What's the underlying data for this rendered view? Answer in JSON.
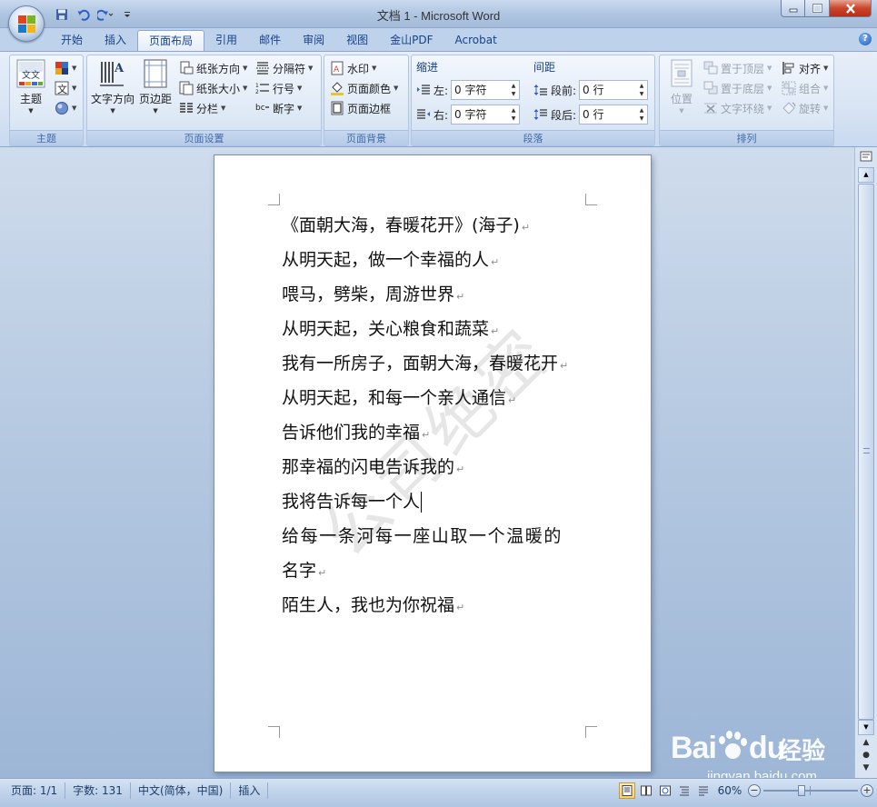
{
  "app": {
    "title": "文档 1 - Microsoft Word"
  },
  "tabs": [
    "开始",
    "插入",
    "页面布局",
    "引用",
    "邮件",
    "审阅",
    "视图",
    "金山PDF",
    "Acrobat"
  ],
  "active_tab": "页面布局",
  "ribbon": {
    "themes": {
      "label": "主题",
      "theme_button": "主题"
    },
    "page_setup": {
      "label": "页面设置",
      "text_direction": "文字方向",
      "margins": "页边距",
      "orientation": "纸张方向",
      "size": "纸张大小",
      "columns": "分栏",
      "breaks": "分隔符",
      "line_numbers": "行号",
      "hyphenation": "断字"
    },
    "page_background": {
      "label": "页面背景",
      "watermark": "水印",
      "page_color": "页面颜色",
      "page_borders": "页面边框"
    },
    "paragraph": {
      "label": "段落",
      "indent_title": "缩进",
      "spacing_title": "间距",
      "indent_left_label": "左:",
      "indent_left_value": "0 字符",
      "indent_right_label": "右:",
      "indent_right_value": "0 字符",
      "spacing_before_label": "段前:",
      "spacing_before_value": "0 行",
      "spacing_after_label": "段后:",
      "spacing_after_value": "0 行"
    },
    "arrange": {
      "label": "排列",
      "position": "位置",
      "bring_to_front": "置于顶层",
      "send_to_back": "置于底层",
      "text_wrapping": "文字环绕",
      "align": "对齐",
      "group": "组合",
      "rotate": "旋转"
    }
  },
  "document": {
    "watermark_text": "公司绝密",
    "paragraphs": [
      "《面朝大海，春暖花开》(海子)",
      "从明天起，做一个幸福的人",
      "喂马，劈柴，周游世界",
      "从明天起，关心粮食和蔬菜",
      "我有一所房子，面朝大海，春暖花开",
      "从明天起，和每一个亲人通信",
      "告诉他们我的幸福",
      "那幸福的闪电告诉我的",
      "我将告诉每一个人",
      "给每一条河每一座山取一个温暖的",
      "名字",
      "陌生人，我也为你祝福"
    ]
  },
  "status": {
    "page": "页面: 1/1",
    "words": "字数: 131",
    "language": "中文(简体，中国)",
    "mode": "插入",
    "zoom": "60%",
    "zoom_fraction": 0.4
  },
  "branding": {
    "baidu_text": "Bai",
    "baidu_text2": "du",
    "baidu_cn": "经验",
    "baidu_url": "jingyan.baidu.com"
  },
  "colors": {
    "accent": "#15428b",
    "ribbon_bg": "#dbe6f5",
    "close_button": "#c9452b"
  }
}
